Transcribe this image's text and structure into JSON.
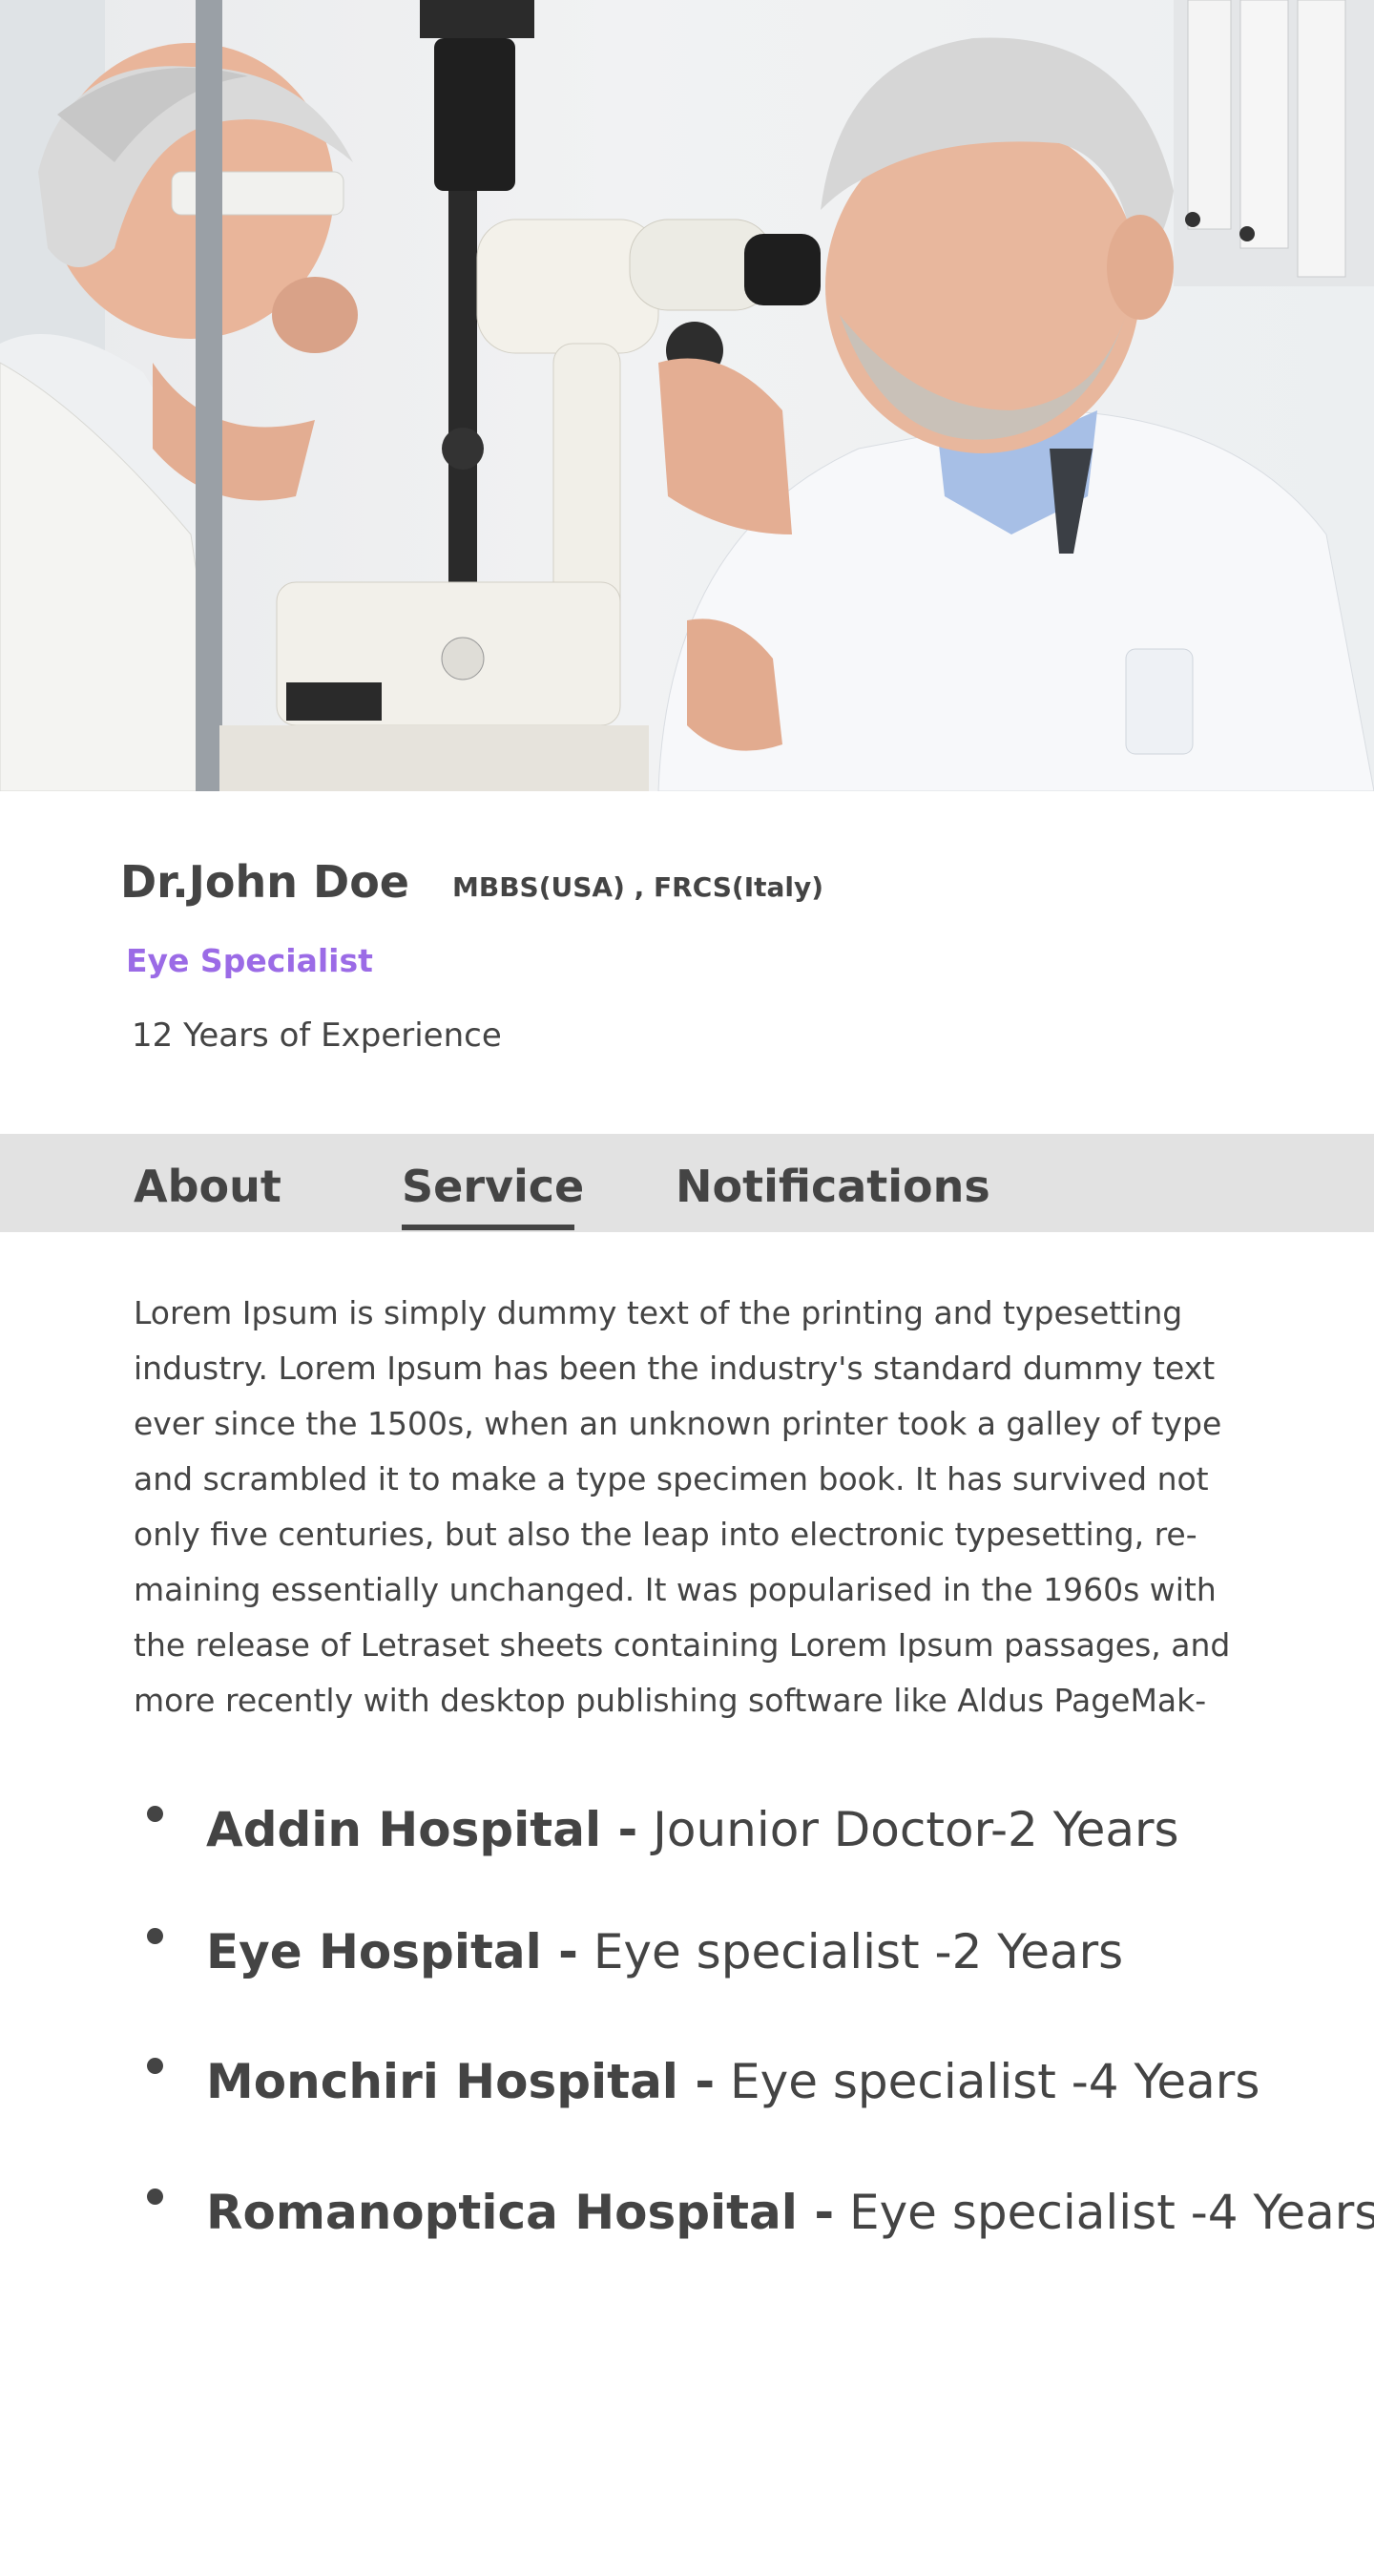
{
  "profile": {
    "name": "Dr.John Doe",
    "qualifications": "MBBS(USA) , FRCS(Italy)",
    "specialty": "Eye Specialist",
    "experience": "12 Years of Experience",
    "photo_icon": "doctor-eye-exam-photo"
  },
  "tabs": {
    "about": "About",
    "service": "Service",
    "notifications": "Notifications",
    "active": "Service"
  },
  "about": {
    "lines": [
      "Lorem Ipsum is simply dummy text of the printing and typesetting",
      "industry. Lorem Ipsum has been the industry's standard dummy text",
      "ever since the 1500s, when an unknown printer took a galley of type",
      "and scrambled it to make a type specimen book. It has survived not",
      "only five centuries, but also the leap into electronic typesetting, re-",
      "maining essentially unchanged. It was popularised in the 1960s with",
      "the release of Letraset sheets containing Lorem Ipsum passages, and",
      "more recently with desktop publishing software like Aldus PageMak-"
    ]
  },
  "experience": [
    {
      "hospital": "Addin Hospital -",
      "role": "Jounior Doctor-2 Years"
    },
    {
      "hospital": "Eye Hospital -",
      "role": "Eye specialist -2 Years"
    },
    {
      "hospital": "Monchiri Hospital -",
      "role": "Eye specialist -4 Years"
    },
    {
      "hospital": "Romanoptica Hospital -",
      "role": "Eye specialist -4 Years"
    }
  ],
  "colors": {
    "accent": "#9b6be6",
    "text": "#444444",
    "tab_bar": "#e2e2e2"
  }
}
